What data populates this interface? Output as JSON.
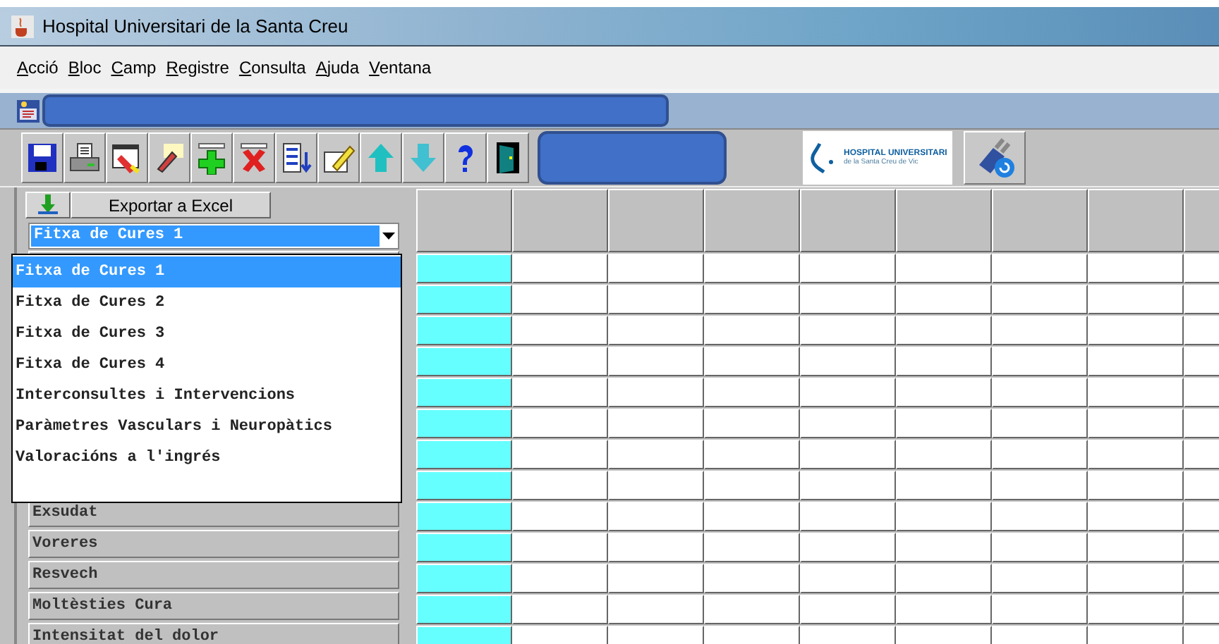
{
  "window": {
    "title": "Hospital Universitari de la Santa Creu"
  },
  "menu": [
    {
      "label": "Acció"
    },
    {
      "label": "Bloc"
    },
    {
      "label": "Camp"
    },
    {
      "label": "Registre"
    },
    {
      "label": "Consulta"
    },
    {
      "label": "Ajuda"
    },
    {
      "label": "Ventana"
    }
  ],
  "logo": {
    "line_1": "HOSPITAL UNIVERSITARI",
    "line_2": "de la Santa Creu de Vic"
  },
  "export_button": {
    "label": "Exportar a Excel"
  },
  "form_select": {
    "value": "Fitxa de Cures 1",
    "expanded": true,
    "options": [
      {
        "label": "Fitxa de Cures 1",
        "selected": true
      },
      {
        "label": "Fitxa de Cures 2",
        "selected": false
      },
      {
        "label": "Fitxa de Cures 3",
        "selected": false
      },
      {
        "label": "Fitxa de Cures 4",
        "selected": false
      },
      {
        "label": "Interconsultes i Intervencions",
        "selected": false
      },
      {
        "label": "Paràmetres Vasculars i Neuropàtics",
        "selected": false
      },
      {
        "label": "Valoracións a l'ingrés",
        "selected": false
      }
    ]
  },
  "grid": {
    "rows": [
      {
        "label": "Exsudat"
      },
      {
        "label": "Voreres"
      },
      {
        "label": "Resvech"
      },
      {
        "label": "Moltèsties Cura"
      },
      {
        "label": "Intensitat del dolor"
      }
    ]
  }
}
